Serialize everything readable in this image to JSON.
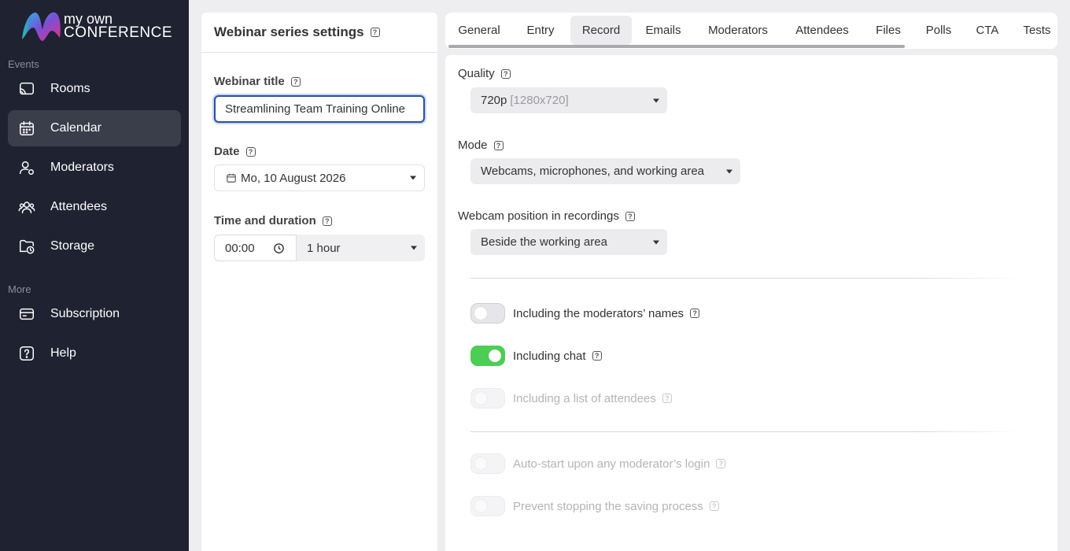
{
  "brand": {
    "line1": "my own",
    "line2": "CONFERENCE"
  },
  "sidebar": {
    "events_label": "Events",
    "more_label": "More",
    "items": [
      {
        "label": "Rooms",
        "icon": "cast-icon"
      },
      {
        "label": "Calendar",
        "icon": "calendar-icon",
        "active": true
      },
      {
        "label": "Moderators",
        "icon": "moderator-icon"
      },
      {
        "label": "Attendees",
        "icon": "attendees-icon"
      },
      {
        "label": "Storage",
        "icon": "folder-clock-icon"
      },
      {
        "label": "Subscription",
        "icon": "wallet-icon"
      },
      {
        "label": "Help",
        "icon": "help-icon"
      }
    ]
  },
  "settings": {
    "title": "Webinar series settings",
    "webinar_title_label": "Webinar title",
    "webinar_title_value": "Streamlining Team Training Online",
    "date_label": "Date",
    "date_value": "Mo, 10 August 2026",
    "time_label": "Time and duration",
    "time_value": "00:00",
    "duration_value": "1 hour"
  },
  "tabs": [
    "General",
    "Entry",
    "Record",
    "Emails",
    "Moderators",
    "Attendees",
    "Files",
    "Polls",
    "CTA",
    "Tests"
  ],
  "active_tab": "Record",
  "record": {
    "quality_label": "Quality",
    "quality_value": "720p",
    "quality_detail": "[1280x720]",
    "mode_label": "Mode",
    "mode_value": "Webcams, microphones, and working area",
    "webcam_position_label": "Webcam position in recordings",
    "webcam_position_value": "Beside the working area",
    "toggles": [
      {
        "label": "Including the moderators’ names",
        "on": false,
        "disabled": false
      },
      {
        "label": "Including chat",
        "on": true,
        "disabled": false
      },
      {
        "label": "Including a list of attendees",
        "on": false,
        "disabled": true
      },
      {
        "label": "Auto-start upon any moderator’s login",
        "on": false,
        "disabled": true
      },
      {
        "label": "Prevent stopping the saving process",
        "on": false,
        "disabled": true
      }
    ]
  },
  "colors": {
    "sidebar_bg": "#1f2230",
    "active_nav_bg": "#3a3d4a",
    "toggle_on": "#4cce55",
    "focus_border": "#2950a8"
  }
}
